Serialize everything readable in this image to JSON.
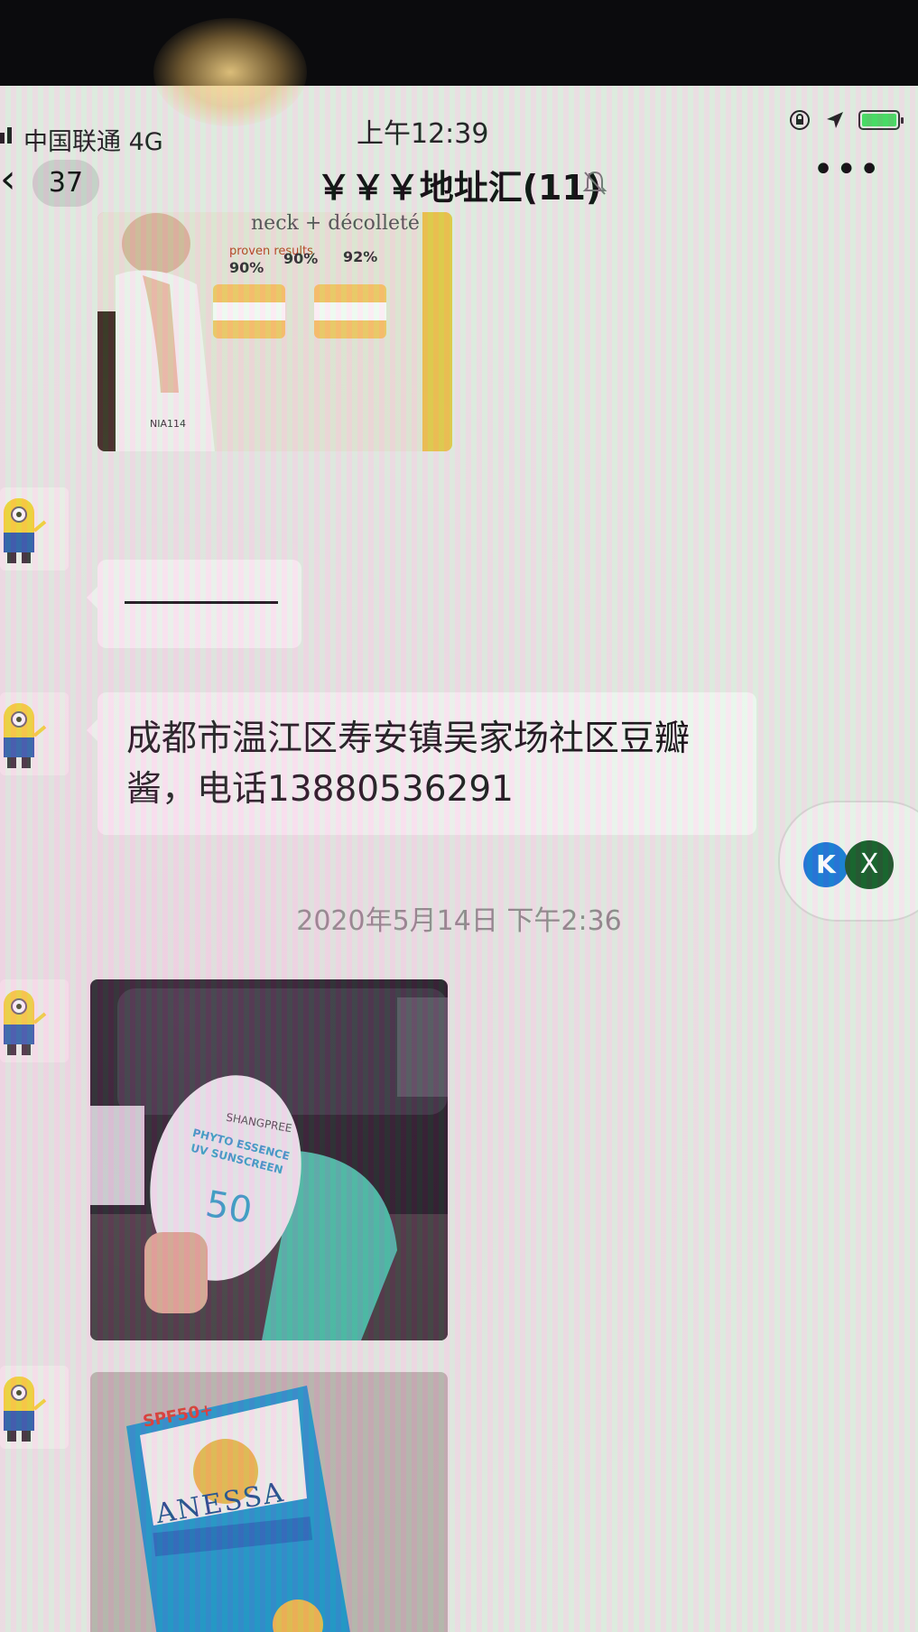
{
  "status_bar": {
    "carrier": "中国联通 4G",
    "time": "上午12:39"
  },
  "nav": {
    "back_count": "37",
    "title": "￥￥￥地址汇(11)",
    "more_icon": "more-icon"
  },
  "messages": {
    "dash_text": "————",
    "address": "成都市温江区寿安镇吴家场社区豆瓣酱，电话13880536291",
    "timestamp": "2020年5月14日 下午2:36"
  },
  "images": {
    "first": {
      "heading": "neck + décolleté",
      "subheading": "proven results",
      "stats": [
        "90%",
        "90%",
        "92%"
      ],
      "brand": "NIA114"
    },
    "second": {
      "brand": "SHANGPREE",
      "line1": "PHYTO ESSENCE",
      "line2": "UV SUNSCREEN",
      "spf": "50"
    },
    "third": {
      "brand": "ANESSA",
      "spf": "SPF50+"
    }
  },
  "floating": {
    "k_label": "K",
    "x_label": "X"
  },
  "colors": {
    "accent_blue": "#1e7ad6",
    "accent_green": "#1b5e2b",
    "battery_green": "#4cd964"
  }
}
